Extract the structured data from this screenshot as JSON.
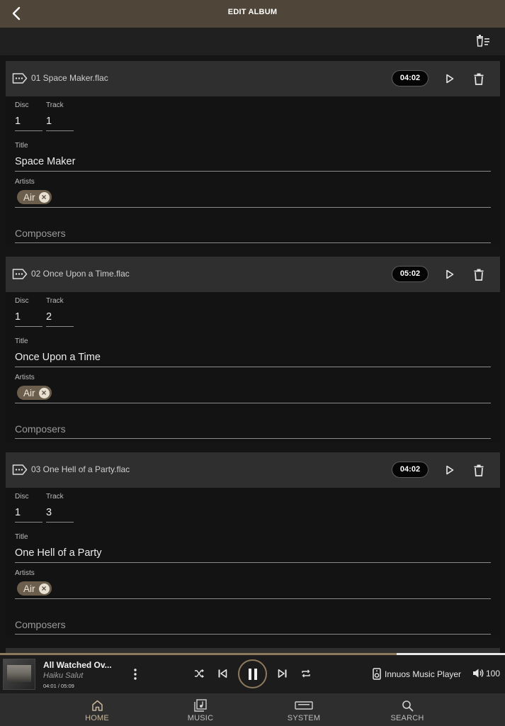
{
  "header": {
    "title": "EDIT ALBUM"
  },
  "labels": {
    "disc": "Disc",
    "track": "Track",
    "title": "Title",
    "artists": "Artists",
    "composers": "Composers"
  },
  "tracks": [
    {
      "file": "01 Space Maker.flac",
      "duration": "04:02",
      "disc": "1",
      "track": "1",
      "title": "Space Maker",
      "artists": [
        "Air"
      ]
    },
    {
      "file": "02 Once Upon a Time.flac",
      "duration": "05:02",
      "disc": "1",
      "track": "2",
      "title": "Once Upon a Time",
      "artists": [
        "Air"
      ]
    },
    {
      "file": "03 One Hell of a Party.flac",
      "duration": "04:02",
      "disc": "1",
      "track": "3",
      "title": "One Hell of a Party",
      "artists": [
        "Air"
      ]
    }
  ],
  "player": {
    "title": "All Watched Ov...",
    "artist": "Haiku Salut",
    "time": "04:01 / 05:09",
    "progress_fraction": 0.785,
    "device": "Innuos Music Player",
    "volume": "100"
  },
  "nav": [
    {
      "label": "HOME",
      "icon": "home-icon",
      "active": true
    },
    {
      "label": "MUSIC",
      "icon": "music-library-icon",
      "active": false
    },
    {
      "label": "SYSTEM",
      "icon": "system-icon",
      "active": false
    },
    {
      "label": "SEARCH",
      "icon": "search-icon",
      "active": false
    }
  ],
  "colors": {
    "accent": "#8d7a5d",
    "chip": "#6b5e4c",
    "header": "#4f4639",
    "background": "#151515"
  }
}
